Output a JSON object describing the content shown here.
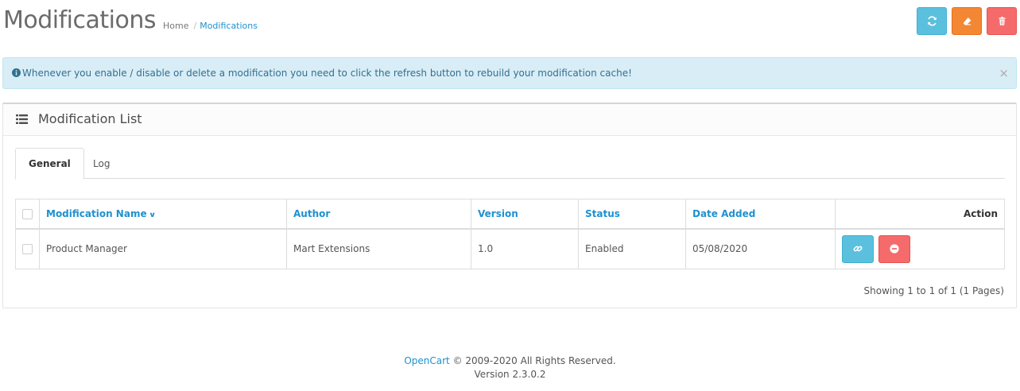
{
  "header": {
    "title": "Modifications",
    "breadcrumb": {
      "home": "Home",
      "separator": "/",
      "current": "Modifications"
    },
    "toolbar": [
      {
        "name": "refresh",
        "icon": "refresh-icon",
        "color": "#5bc0de"
      },
      {
        "name": "clear",
        "icon": "eraser-icon",
        "color": "#f38733"
      },
      {
        "name": "delete",
        "icon": "trash-icon",
        "color": "#f56b6b"
      }
    ]
  },
  "alert": {
    "icon": "info-circle-icon",
    "text": "Whenever you enable / disable or delete a modification you need to click the refresh button to rebuild your modification cache!",
    "close": "×"
  },
  "panel": {
    "icon": "list-icon",
    "title": "Modification List",
    "tabs": [
      {
        "label": "General",
        "active": true
      },
      {
        "label": "Log",
        "active": false
      }
    ],
    "table": {
      "columns": [
        "Modification Name",
        "Author",
        "Version",
        "Status",
        "Date Added",
        "Action"
      ],
      "sort_indicator": "chevron-down-icon",
      "rows": [
        {
          "name": "Product Manager",
          "author": "Mart Extensions",
          "version": "1.0",
          "status": "Enabled",
          "date_added": "05/08/2020",
          "actions": [
            {
              "icon": "link-icon",
              "color": "#5bc0de"
            },
            {
              "icon": "minus-circle-icon",
              "color": "#f56b6b"
            }
          ]
        }
      ]
    },
    "results": "Showing 1 to 1 of 1 (1 Pages)"
  },
  "footer": {
    "brand": "OpenCart",
    "copyright": " © 2009-2020 All Rights Reserved.",
    "version": "Version 2.3.0.2"
  },
  "colors": {
    "primary_link": "#1e91cf",
    "info": "#5bc0de",
    "warning": "#f38733",
    "danger": "#f56b6b",
    "alert_bg": "#d9edf7"
  }
}
